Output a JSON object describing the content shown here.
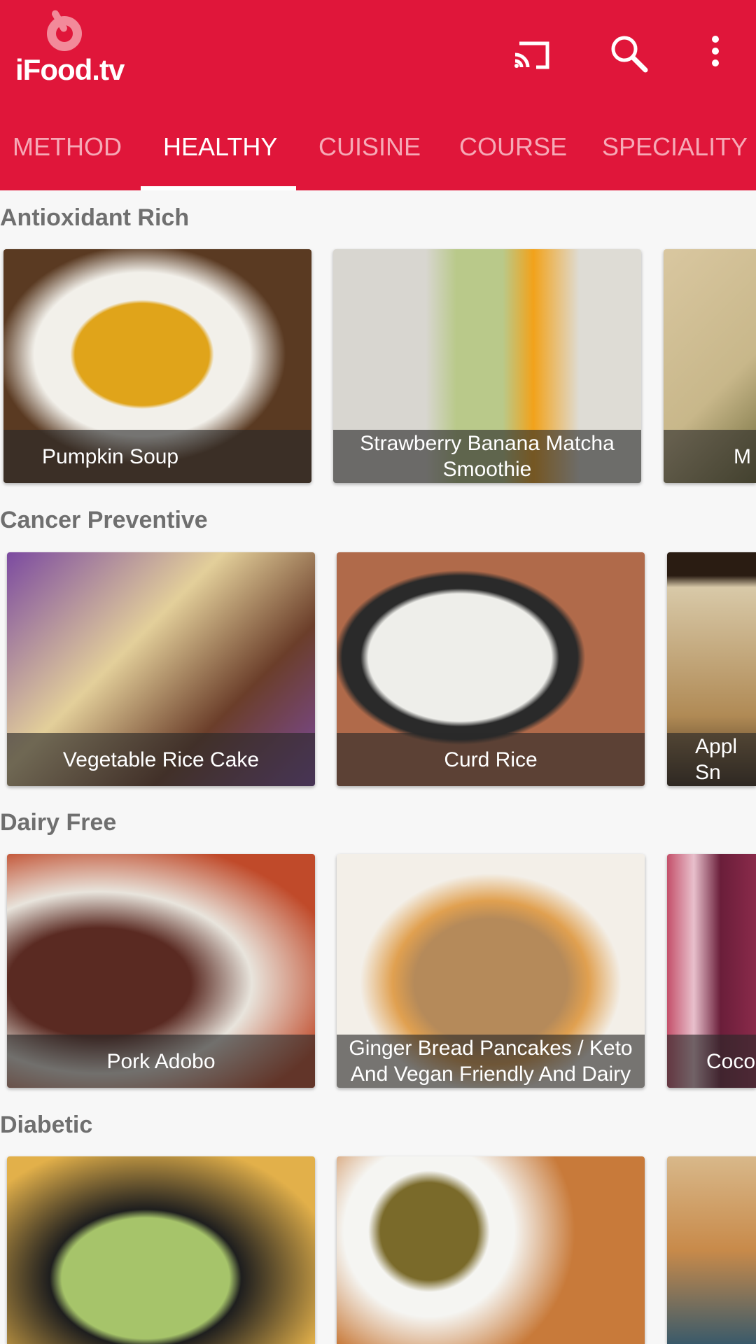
{
  "header": {
    "logo_text": "iFood.tv",
    "brand_color": "#e0163a",
    "actions": [
      {
        "icon": "cast-icon"
      },
      {
        "icon": "search-icon"
      },
      {
        "icon": "more-vert-icon"
      }
    ]
  },
  "tabs": [
    {
      "label": "METHOD"
    },
    {
      "label": "HEALTHY",
      "active": true
    },
    {
      "label": "CUISINE"
    },
    {
      "label": "COURSE"
    },
    {
      "label": "SPECIALITY"
    }
  ],
  "sections": [
    {
      "title": "Antioxidant Rich",
      "cards": [
        {
          "title": "Pumpkin Soup"
        },
        {
          "title": "Strawberry Banana Matcha Smoothie"
        },
        {
          "title": "M"
        }
      ]
    },
    {
      "title": "Cancer Preventive",
      "cards": [
        {
          "title": "Vegetable Rice Cake"
        },
        {
          "title": "Curd Rice"
        },
        {
          "title": "Appl\nSn"
        }
      ]
    },
    {
      "title": "Dairy Free",
      "cards": [
        {
          "title": "Pork Adobo"
        },
        {
          "title": "Ginger Bread Pancakes / Keto And Vegan Friendly And Dairy"
        },
        {
          "title": "Coco"
        }
      ]
    },
    {
      "title": "Diabetic",
      "cards": [
        {
          "title": ""
        },
        {
          "title": ""
        },
        {
          "title": ""
        }
      ]
    }
  ]
}
